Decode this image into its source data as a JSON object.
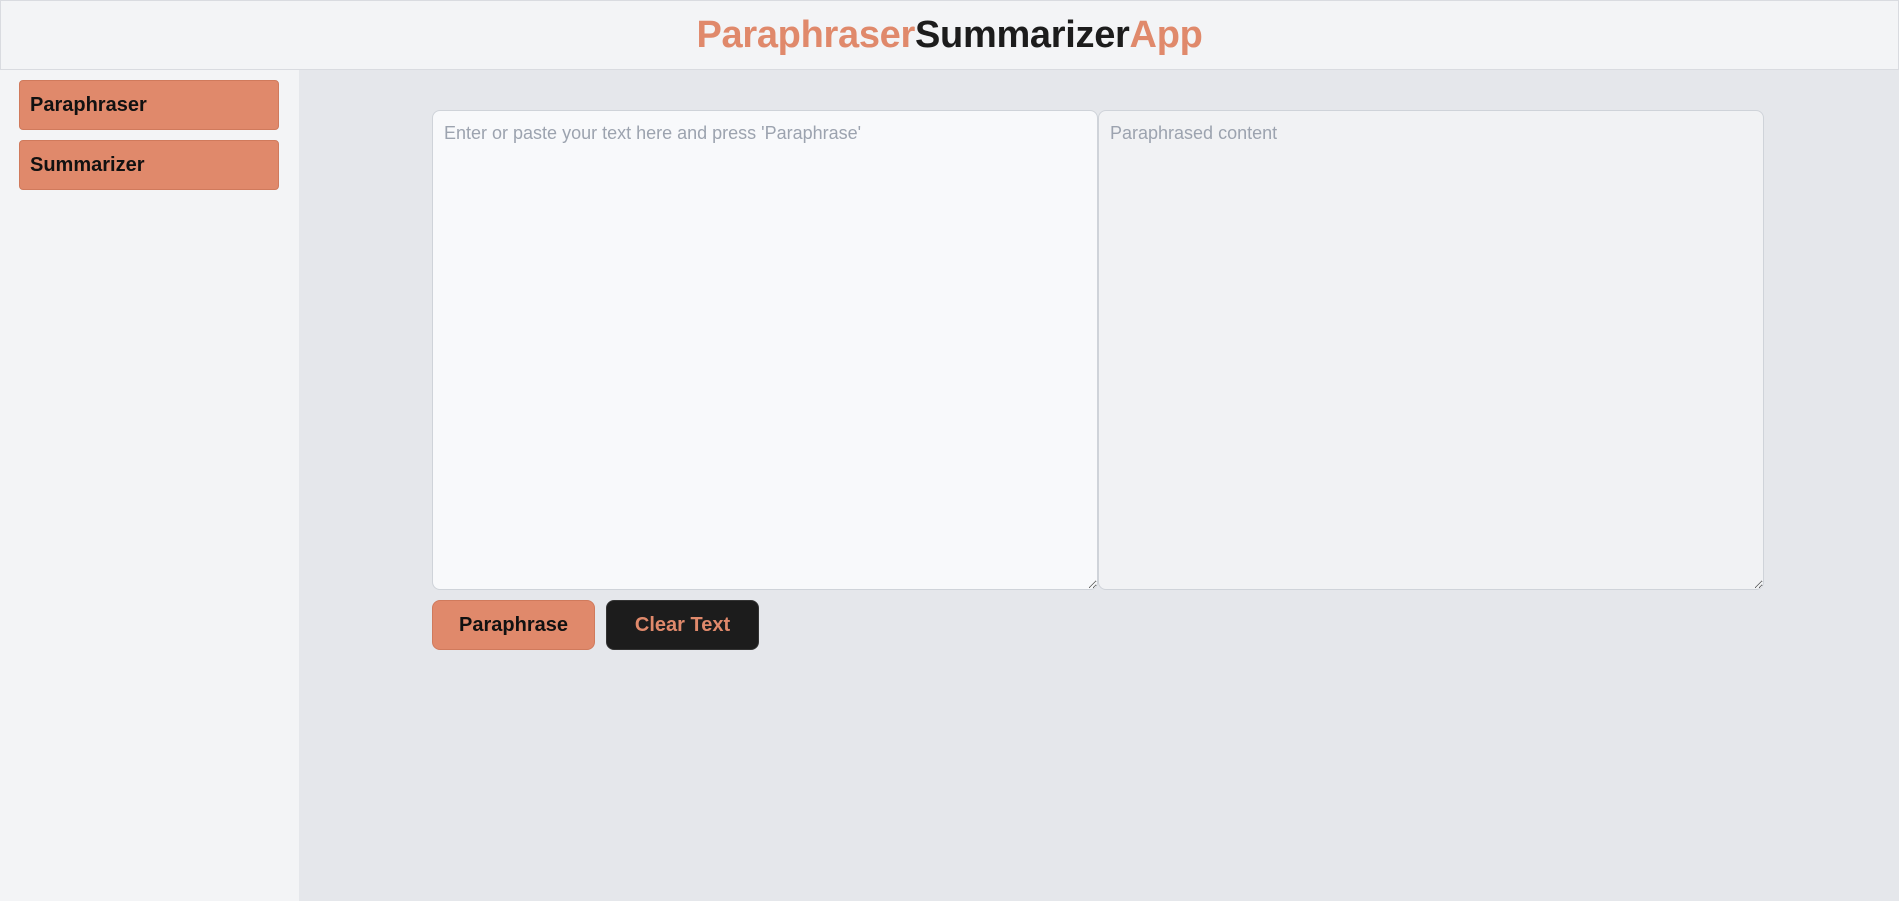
{
  "header": {
    "title_part1": "Paraphraser",
    "title_part2": "Summarizer",
    "title_part3": "App"
  },
  "sidebar": {
    "items": [
      {
        "label": "Paraphraser"
      },
      {
        "label": "Summarizer"
      }
    ]
  },
  "main": {
    "input": {
      "value": "",
      "placeholder": "Enter or paste your text here and press 'Paraphrase'"
    },
    "output": {
      "value": "",
      "placeholder": "Paraphrased content"
    },
    "paraphrase_label": "Paraphrase",
    "clear_label": "Clear Text"
  },
  "colors": {
    "accent": "#e0896b",
    "dark": "#1c1c1c",
    "background": "#e5e7eb",
    "panel": "#f3f4f6"
  }
}
